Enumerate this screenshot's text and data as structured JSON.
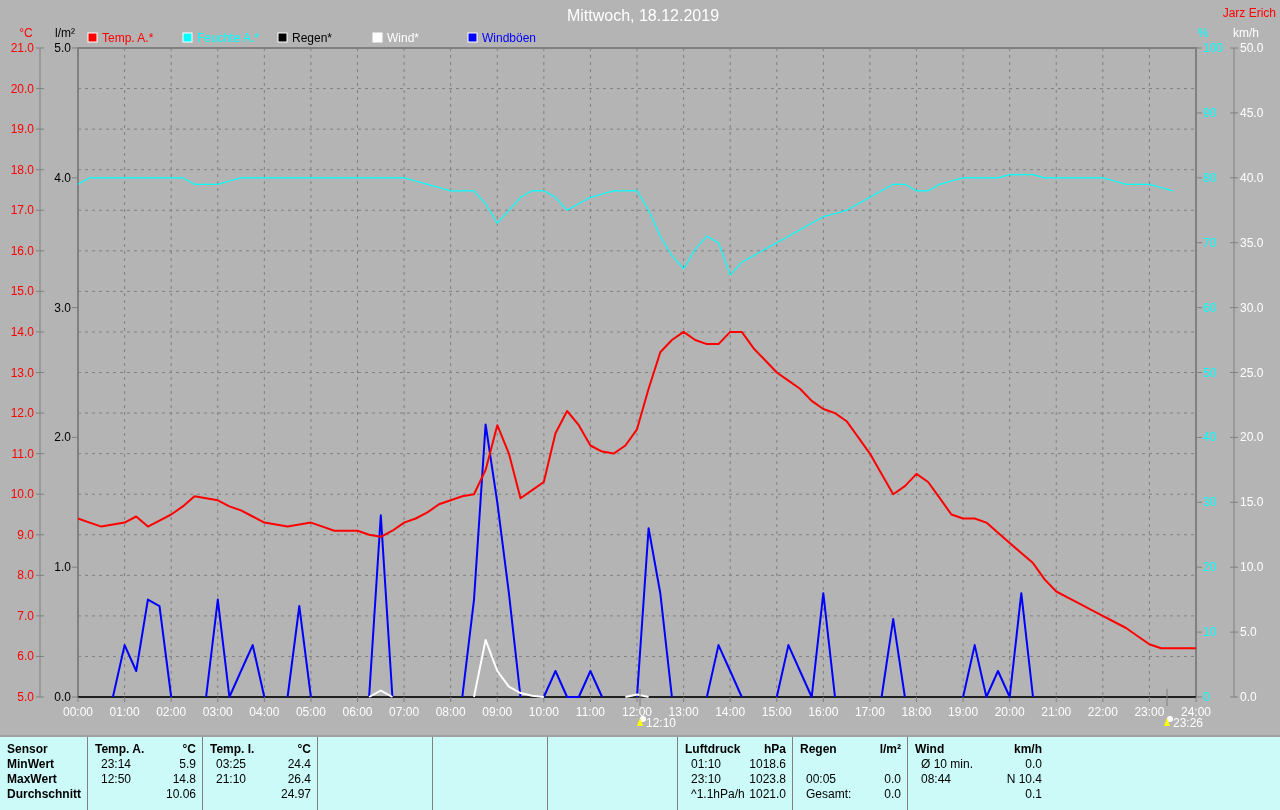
{
  "title": "Mittwoch, 18.12.2019",
  "author": "Jarz Erich",
  "chart_data": {
    "type": "line",
    "legend": "top",
    "grid": true,
    "x": [
      0,
      0.25,
      0.5,
      0.75,
      1,
      1.25,
      1.5,
      1.75,
      2,
      2.25,
      2.5,
      2.75,
      3,
      3.25,
      3.5,
      3.75,
      4,
      4.25,
      4.5,
      4.75,
      5,
      5.25,
      5.5,
      5.75,
      6,
      6.25,
      6.5,
      6.75,
      7,
      7.25,
      7.5,
      7.75,
      8,
      8.25,
      8.5,
      8.75,
      9,
      9.25,
      9.5,
      9.75,
      10,
      10.25,
      10.5,
      10.75,
      11,
      11.25,
      11.5,
      11.75,
      12,
      12.25,
      12.5,
      12.75,
      13,
      13.25,
      13.5,
      13.75,
      14,
      14.25,
      14.5,
      14.75,
      15,
      15.25,
      15.5,
      15.75,
      16,
      16.25,
      16.5,
      16.75,
      17,
      17.25,
      17.5,
      17.75,
      18,
      18.25,
      18.5,
      18.75,
      19,
      19.25,
      19.5,
      19.75,
      20,
      20.25,
      20.5,
      20.75,
      21,
      21.25,
      21.5,
      21.75,
      22,
      22.25,
      22.5,
      22.75,
      23,
      23.25,
      23.5,
      23.75,
      24
    ],
    "xlim": [
      0,
      24
    ],
    "xticks": [
      {
        "value": 0,
        "label": "00:00"
      },
      {
        "value": 1,
        "label": "01:00"
      },
      {
        "value": 2,
        "label": "02:00"
      },
      {
        "value": 3,
        "label": "03:00"
      },
      {
        "value": 4,
        "label": "04:00"
      },
      {
        "value": 5,
        "label": "05:00"
      },
      {
        "value": 6,
        "label": "06:00"
      },
      {
        "value": 7,
        "label": "07:00"
      },
      {
        "value": 8,
        "label": "08:00"
      },
      {
        "value": 9,
        "label": "09:00"
      },
      {
        "value": 10,
        "label": "10:00"
      },
      {
        "value": 11,
        "label": "11:00"
      },
      {
        "value": 12,
        "label": "12:00"
      },
      {
        "value": 13,
        "label": "13:00"
      },
      {
        "value": 14,
        "label": "14:00"
      },
      {
        "value": 15,
        "label": "15:00"
      },
      {
        "value": 16,
        "label": "16:00"
      },
      {
        "value": 17,
        "label": "17:00"
      },
      {
        "value": 18,
        "label": "18:00"
      },
      {
        "value": 19,
        "label": "19:00"
      },
      {
        "value": 20,
        "label": "20:00"
      },
      {
        "value": 21,
        "label": "21:00"
      },
      {
        "value": 22,
        "label": "22:00"
      },
      {
        "value": 23,
        "label": "23:00"
      },
      {
        "value": 24,
        "label": "24:00"
      }
    ],
    "ylim": [
      5,
      21
    ],
    "yticks": [
      {
        "value": 5,
        "label": "5.0"
      },
      {
        "value": 6,
        "label": "6.0"
      },
      {
        "value": 7,
        "label": "7.0"
      },
      {
        "value": 8,
        "label": "8.0"
      },
      {
        "value": 9,
        "label": "9.0"
      },
      {
        "value": 10,
        "label": "10.0"
      },
      {
        "value": 11,
        "label": "11.0"
      },
      {
        "value": 12,
        "label": "12.0"
      },
      {
        "value": 13,
        "label": "13.0"
      },
      {
        "value": 14,
        "label": "14.0"
      },
      {
        "value": 15,
        "label": "15.0"
      },
      {
        "value": 16,
        "label": "16.0"
      },
      {
        "value": 17,
        "label": "17.0"
      },
      {
        "value": 18,
        "label": "18.0"
      },
      {
        "value": 19,
        "label": "19.0"
      },
      {
        "value": 20,
        "label": "20.0"
      },
      {
        "value": 21,
        "label": "21.0"
      }
    ],
    "ylabel": "°C",
    "y2lim": [
      0,
      100
    ],
    "y2label": "%",
    "y2ticks": [
      {
        "value": 0,
        "label": "0"
      },
      {
        "value": 10,
        "label": "10"
      },
      {
        "value": 20,
        "label": "20"
      },
      {
        "value": 30,
        "label": "30"
      },
      {
        "value": 40,
        "label": "40"
      },
      {
        "value": 50,
        "label": "50"
      },
      {
        "value": 60,
        "label": "60"
      },
      {
        "value": 70,
        "label": "70"
      },
      {
        "value": 80,
        "label": "80"
      },
      {
        "value": 90,
        "label": "90"
      },
      {
        "value": 100,
        "label": "100"
      }
    ],
    "y3lim": [
      0,
      50
    ],
    "y3label": "km/h",
    "y3ticks": [
      {
        "value": 0,
        "label": "0.0"
      },
      {
        "value": 5,
        "label": "5.0"
      },
      {
        "value": 10,
        "label": "10.0"
      },
      {
        "value": 15,
        "label": "15.0"
      },
      {
        "value": 20,
        "label": "20.0"
      },
      {
        "value": 25,
        "label": "25.0"
      },
      {
        "value": 30,
        "label": "30.0"
      },
      {
        "value": 35,
        "label": "35.0"
      },
      {
        "value": 40,
        "label": "40.0"
      },
      {
        "value": 45,
        "label": "45.0"
      },
      {
        "value": 50,
        "label": "50.0"
      }
    ],
    "series": [
      {
        "name": "Temp. A.*",
        "color": "#ff0000",
        "axis": "y",
        "values": [
          9.4,
          9.3,
          9.2,
          9.25,
          9.3,
          9.45,
          9.2,
          9.35,
          9.5,
          9.7,
          9.95,
          9.9,
          9.85,
          9.7,
          9.6,
          9.45,
          9.3,
          9.25,
          9.2,
          9.25,
          9.3,
          9.2,
          9.1,
          9.1,
          9.1,
          9.0,
          8.95,
          9.1,
          9.3,
          9.4,
          9.55,
          9.75,
          9.85,
          9.95,
          10.0,
          10.6,
          11.7,
          11.0,
          9.9,
          10.1,
          10.3,
          11.5,
          12.05,
          11.7,
          11.2,
          11.05,
          11.0,
          11.2,
          11.6,
          12.6,
          13.5,
          13.8,
          14.0,
          13.8,
          13.7,
          13.7,
          14.0,
          14.0,
          13.6,
          13.3,
          13.0,
          12.8,
          12.6,
          12.3,
          12.1,
          12.0,
          11.8,
          11.4,
          11.0,
          10.5,
          10.0,
          10.2,
          10.5,
          10.3,
          9.9,
          9.5,
          9.4,
          9.4,
          9.3,
          9.05,
          8.8,
          8.55,
          8.3,
          7.9,
          7.6,
          7.45,
          7.3,
          7.15,
          7.0,
          6.85,
          6.7,
          6.5,
          6.3,
          6.2,
          6.2,
          6.2,
          6.2
        ]
      },
      {
        "name": "Feuchte A.*",
        "color": "#00ffff",
        "axis": "y2",
        "values": [
          79,
          80,
          80,
          80,
          80,
          80,
          80,
          80,
          80,
          80,
          79,
          79,
          79,
          79.5,
          80,
          80,
          80,
          80,
          80,
          80,
          80,
          80,
          80,
          80,
          80,
          80,
          80,
          80,
          80,
          79.5,
          79,
          78.5,
          78,
          78,
          78,
          76,
          73,
          75,
          77,
          78,
          78,
          77,
          75,
          76,
          77,
          77.5,
          78,
          78,
          78,
          75,
          71,
          68,
          66,
          69,
          71,
          70,
          65,
          67,
          68,
          69,
          70,
          71,
          72,
          73,
          74,
          74.5,
          75,
          76,
          77,
          78,
          79,
          79,
          78,
          78,
          79,
          79.5,
          80,
          80,
          80,
          80,
          80.5,
          80.5,
          80.5,
          80,
          80,
          80,
          80,
          80,
          80,
          79.5,
          79,
          79,
          79,
          78.5,
          78,
          null,
          null
        ]
      },
      {
        "name": "Regen*",
        "color": "#000000",
        "axis": "y2",
        "values": [
          null,
          null,
          null,
          null,
          null,
          null,
          null,
          null,
          null,
          null,
          null,
          null,
          null,
          null,
          null,
          null,
          null,
          null,
          null,
          null,
          null,
          null,
          null,
          null,
          null,
          null,
          null,
          null,
          null,
          null,
          null,
          null,
          null,
          null,
          null,
          null,
          null,
          null,
          null,
          null,
          null,
          null,
          null,
          null,
          null,
          null,
          null,
          null,
          null,
          null,
          null,
          null,
          null,
          null,
          null,
          null,
          null,
          null,
          null,
          null,
          null,
          null,
          null,
          null,
          null,
          null,
          null,
          null,
          null,
          null,
          null,
          null,
          null,
          null,
          null,
          null,
          null,
          null,
          null,
          null,
          null,
          null,
          null,
          null,
          null,
          null,
          null,
          null,
          null,
          null,
          null,
          null,
          null,
          null,
          null,
          null,
          null
        ]
      },
      {
        "name": "Wind*",
        "color": "#ffffff",
        "axis": "y3",
        "values": [
          null,
          null,
          null,
          null,
          null,
          null,
          null,
          null,
          null,
          null,
          null,
          null,
          null,
          null,
          null,
          null,
          null,
          null,
          null,
          null,
          null,
          null,
          null,
          null,
          null,
          0,
          0.5,
          0,
          null,
          null,
          null,
          null,
          null,
          null,
          0,
          4.4,
          2,
          0.8,
          0.3,
          0.1,
          0,
          null,
          null,
          null,
          null,
          null,
          null,
          0,
          0.2,
          0,
          null,
          null,
          null,
          null,
          null,
          null,
          null,
          null,
          null,
          null,
          null,
          null,
          null,
          null,
          null,
          null,
          null,
          null,
          null,
          null,
          null,
          null,
          null,
          null,
          null,
          null,
          null,
          null,
          null,
          null,
          null,
          null,
          null,
          null,
          null,
          null,
          null,
          null,
          null,
          null,
          null,
          null,
          null,
          null,
          null,
          null,
          null
        ]
      },
      {
        "name": "Windböen",
        "color": "#0000ff",
        "axis": "y3",
        "values": [
          null,
          null,
          null,
          0,
          4,
          2,
          7.5,
          7,
          0,
          null,
          null,
          0,
          7.5,
          0,
          2,
          4,
          0,
          null,
          0,
          7,
          0,
          null,
          null,
          null,
          null,
          0,
          14,
          0,
          null,
          null,
          null,
          null,
          null,
          0,
          7.5,
          21,
          15,
          8,
          0,
          null,
          0,
          2,
          0,
          0,
          2,
          0,
          null,
          null,
          0,
          13,
          8,
          0,
          null,
          null,
          0,
          4,
          2,
          0,
          null,
          null,
          0,
          4,
          2,
          0,
          8,
          0,
          null,
          null,
          null,
          0,
          6,
          0,
          null,
          null,
          null,
          null,
          0,
          4,
          0,
          2,
          0,
          8,
          0,
          null,
          null,
          null,
          null,
          null,
          null,
          null,
          null,
          null,
          null,
          null,
          null,
          null,
          null
        ]
      }
    ],
    "annotations": [
      "12:10",
      "23:26"
    ]
  },
  "rain_axis": {
    "unit": "l/m²",
    "ticks": [
      "5.0",
      "4.0",
      "3.0",
      "2.0",
      "1.0",
      "0.0"
    ]
  },
  "stats": {
    "row_labels": [
      "Sensor",
      "MinWert",
      "MaxWert",
      "Durchschnitt"
    ],
    "columns": [
      {
        "kind": "data",
        "name": "Temp. A.",
        "unit": "°C",
        "rows": [
          {
            "time": "23:14",
            "value": "5.9"
          },
          {
            "time": "12:50",
            "value": "14.8"
          },
          {
            "value": "10.06"
          }
        ]
      },
      {
        "kind": "data",
        "name": "Temp. I.",
        "unit": "°C",
        "rows": [
          {
            "time": "03:25",
            "value": "24.4"
          },
          {
            "time": "21:10",
            "value": "26.4"
          },
          {
            "value": "24.97"
          }
        ]
      },
      {
        "kind": "empty"
      },
      {
        "kind": "empty"
      },
      {
        "kind": "empty"
      },
      {
        "kind": "data",
        "name": "Luftdruck",
        "unit": "hPa",
        "rows": [
          {
            "time": "01:10",
            "value": "1018.6"
          },
          {
            "time": "23:10",
            "value": "1023.8"
          },
          {
            "time": "^1.1hPa/h",
            "value": "1021.0"
          }
        ]
      },
      {
        "kind": "data",
        "name": "Regen",
        "unit": "l/m²",
        "rows": [
          {},
          {
            "time": "00:05",
            "value": "0.0"
          },
          {
            "time": "Gesamt:",
            "value": "0.0"
          }
        ]
      },
      {
        "kind": "data",
        "name": "Wind",
        "unit": "km/h",
        "rows": [
          {
            "time": "Ø 10 min.",
            "value": "0.0"
          },
          {
            "time": "08:44",
            "value": "N 10.4"
          },
          {
            "value": "0.1"
          }
        ]
      }
    ]
  }
}
